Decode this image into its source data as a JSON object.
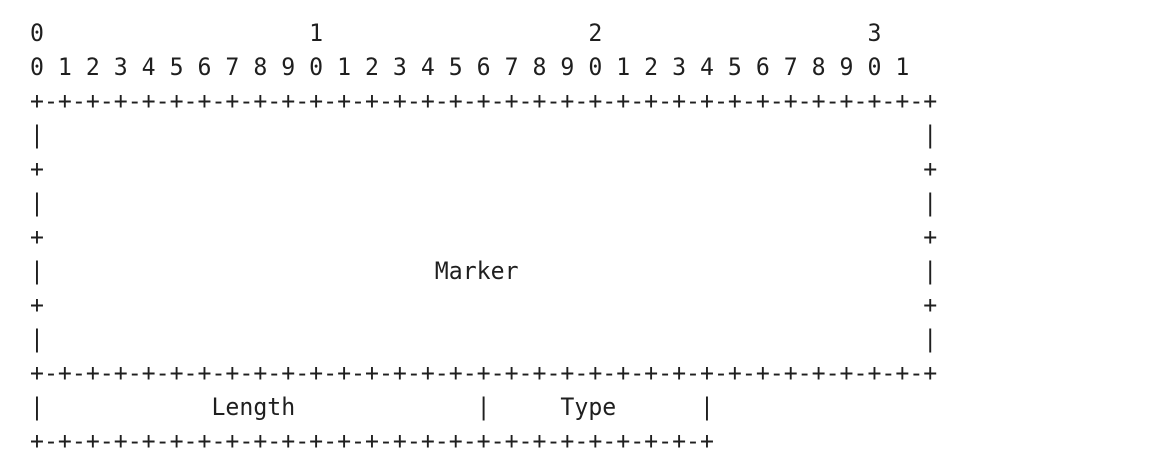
{
  "bit_ruler": {
    "tens": "0                   1                   2                   3",
    "units": "0 1 2 3 4 5 6 7 8 9 0 1 2 3 4 5 6 7 8 9 0 1 2 3 4 5 6 7 8 9 0 1"
  },
  "rows": [
    "+-+-+-+-+-+-+-+-+-+-+-+-+-+-+-+-+-+-+-+-+-+-+-+-+-+-+-+-+-+-+-+-+",
    "|                                                               |",
    "+                                                               +",
    "|                                                               |",
    "+                                                               +",
    "|                            Marker                             |",
    "+                                                               +",
    "|                                                               |",
    "+-+-+-+-+-+-+-+-+-+-+-+-+-+-+-+-+-+-+-+-+-+-+-+-+-+-+-+-+-+-+-+-+",
    "|            Length             |     Type      |",
    "+-+-+-+-+-+-+-+-+-+-+-+-+-+-+-+-+-+-+-+-+-+-+-+-+"
  ],
  "fields": {
    "marker": "Marker",
    "length": "Length",
    "type": "Type"
  }
}
